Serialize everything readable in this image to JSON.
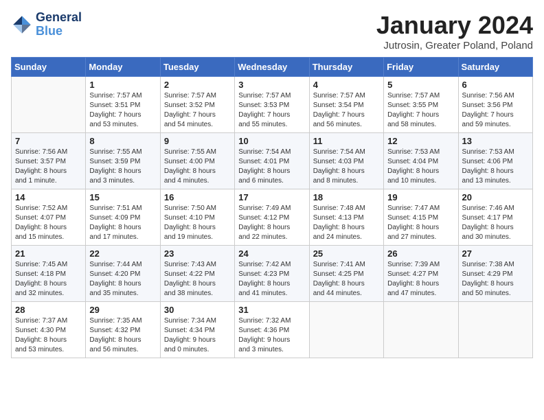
{
  "header": {
    "logo_line1": "General",
    "logo_line2": "Blue",
    "month_title": "January 2024",
    "location": "Jutrosin, Greater Poland, Poland"
  },
  "weekdays": [
    "Sunday",
    "Monday",
    "Tuesday",
    "Wednesday",
    "Thursday",
    "Friday",
    "Saturday"
  ],
  "weeks": [
    [
      {
        "day": "",
        "info": ""
      },
      {
        "day": "1",
        "info": "Sunrise: 7:57 AM\nSunset: 3:51 PM\nDaylight: 7 hours\nand 53 minutes."
      },
      {
        "day": "2",
        "info": "Sunrise: 7:57 AM\nSunset: 3:52 PM\nDaylight: 7 hours\nand 54 minutes."
      },
      {
        "day": "3",
        "info": "Sunrise: 7:57 AM\nSunset: 3:53 PM\nDaylight: 7 hours\nand 55 minutes."
      },
      {
        "day": "4",
        "info": "Sunrise: 7:57 AM\nSunset: 3:54 PM\nDaylight: 7 hours\nand 56 minutes."
      },
      {
        "day": "5",
        "info": "Sunrise: 7:57 AM\nSunset: 3:55 PM\nDaylight: 7 hours\nand 58 minutes."
      },
      {
        "day": "6",
        "info": "Sunrise: 7:56 AM\nSunset: 3:56 PM\nDaylight: 7 hours\nand 59 minutes."
      }
    ],
    [
      {
        "day": "7",
        "info": "Sunrise: 7:56 AM\nSunset: 3:57 PM\nDaylight: 8 hours\nand 1 minute."
      },
      {
        "day": "8",
        "info": "Sunrise: 7:55 AM\nSunset: 3:59 PM\nDaylight: 8 hours\nand 3 minutes."
      },
      {
        "day": "9",
        "info": "Sunrise: 7:55 AM\nSunset: 4:00 PM\nDaylight: 8 hours\nand 4 minutes."
      },
      {
        "day": "10",
        "info": "Sunrise: 7:54 AM\nSunset: 4:01 PM\nDaylight: 8 hours\nand 6 minutes."
      },
      {
        "day": "11",
        "info": "Sunrise: 7:54 AM\nSunset: 4:03 PM\nDaylight: 8 hours\nand 8 minutes."
      },
      {
        "day": "12",
        "info": "Sunrise: 7:53 AM\nSunset: 4:04 PM\nDaylight: 8 hours\nand 10 minutes."
      },
      {
        "day": "13",
        "info": "Sunrise: 7:53 AM\nSunset: 4:06 PM\nDaylight: 8 hours\nand 13 minutes."
      }
    ],
    [
      {
        "day": "14",
        "info": "Sunrise: 7:52 AM\nSunset: 4:07 PM\nDaylight: 8 hours\nand 15 minutes."
      },
      {
        "day": "15",
        "info": "Sunrise: 7:51 AM\nSunset: 4:09 PM\nDaylight: 8 hours\nand 17 minutes."
      },
      {
        "day": "16",
        "info": "Sunrise: 7:50 AM\nSunset: 4:10 PM\nDaylight: 8 hours\nand 19 minutes."
      },
      {
        "day": "17",
        "info": "Sunrise: 7:49 AM\nSunset: 4:12 PM\nDaylight: 8 hours\nand 22 minutes."
      },
      {
        "day": "18",
        "info": "Sunrise: 7:48 AM\nSunset: 4:13 PM\nDaylight: 8 hours\nand 24 minutes."
      },
      {
        "day": "19",
        "info": "Sunrise: 7:47 AM\nSunset: 4:15 PM\nDaylight: 8 hours\nand 27 minutes."
      },
      {
        "day": "20",
        "info": "Sunrise: 7:46 AM\nSunset: 4:17 PM\nDaylight: 8 hours\nand 30 minutes."
      }
    ],
    [
      {
        "day": "21",
        "info": "Sunrise: 7:45 AM\nSunset: 4:18 PM\nDaylight: 8 hours\nand 32 minutes."
      },
      {
        "day": "22",
        "info": "Sunrise: 7:44 AM\nSunset: 4:20 PM\nDaylight: 8 hours\nand 35 minutes."
      },
      {
        "day": "23",
        "info": "Sunrise: 7:43 AM\nSunset: 4:22 PM\nDaylight: 8 hours\nand 38 minutes."
      },
      {
        "day": "24",
        "info": "Sunrise: 7:42 AM\nSunset: 4:23 PM\nDaylight: 8 hours\nand 41 minutes."
      },
      {
        "day": "25",
        "info": "Sunrise: 7:41 AM\nSunset: 4:25 PM\nDaylight: 8 hours\nand 44 minutes."
      },
      {
        "day": "26",
        "info": "Sunrise: 7:39 AM\nSunset: 4:27 PM\nDaylight: 8 hours\nand 47 minutes."
      },
      {
        "day": "27",
        "info": "Sunrise: 7:38 AM\nSunset: 4:29 PM\nDaylight: 8 hours\nand 50 minutes."
      }
    ],
    [
      {
        "day": "28",
        "info": "Sunrise: 7:37 AM\nSunset: 4:30 PM\nDaylight: 8 hours\nand 53 minutes."
      },
      {
        "day": "29",
        "info": "Sunrise: 7:35 AM\nSunset: 4:32 PM\nDaylight: 8 hours\nand 56 minutes."
      },
      {
        "day": "30",
        "info": "Sunrise: 7:34 AM\nSunset: 4:34 PM\nDaylight: 9 hours\nand 0 minutes."
      },
      {
        "day": "31",
        "info": "Sunrise: 7:32 AM\nSunset: 4:36 PM\nDaylight: 9 hours\nand 3 minutes."
      },
      {
        "day": "",
        "info": ""
      },
      {
        "day": "",
        "info": ""
      },
      {
        "day": "",
        "info": ""
      }
    ]
  ]
}
